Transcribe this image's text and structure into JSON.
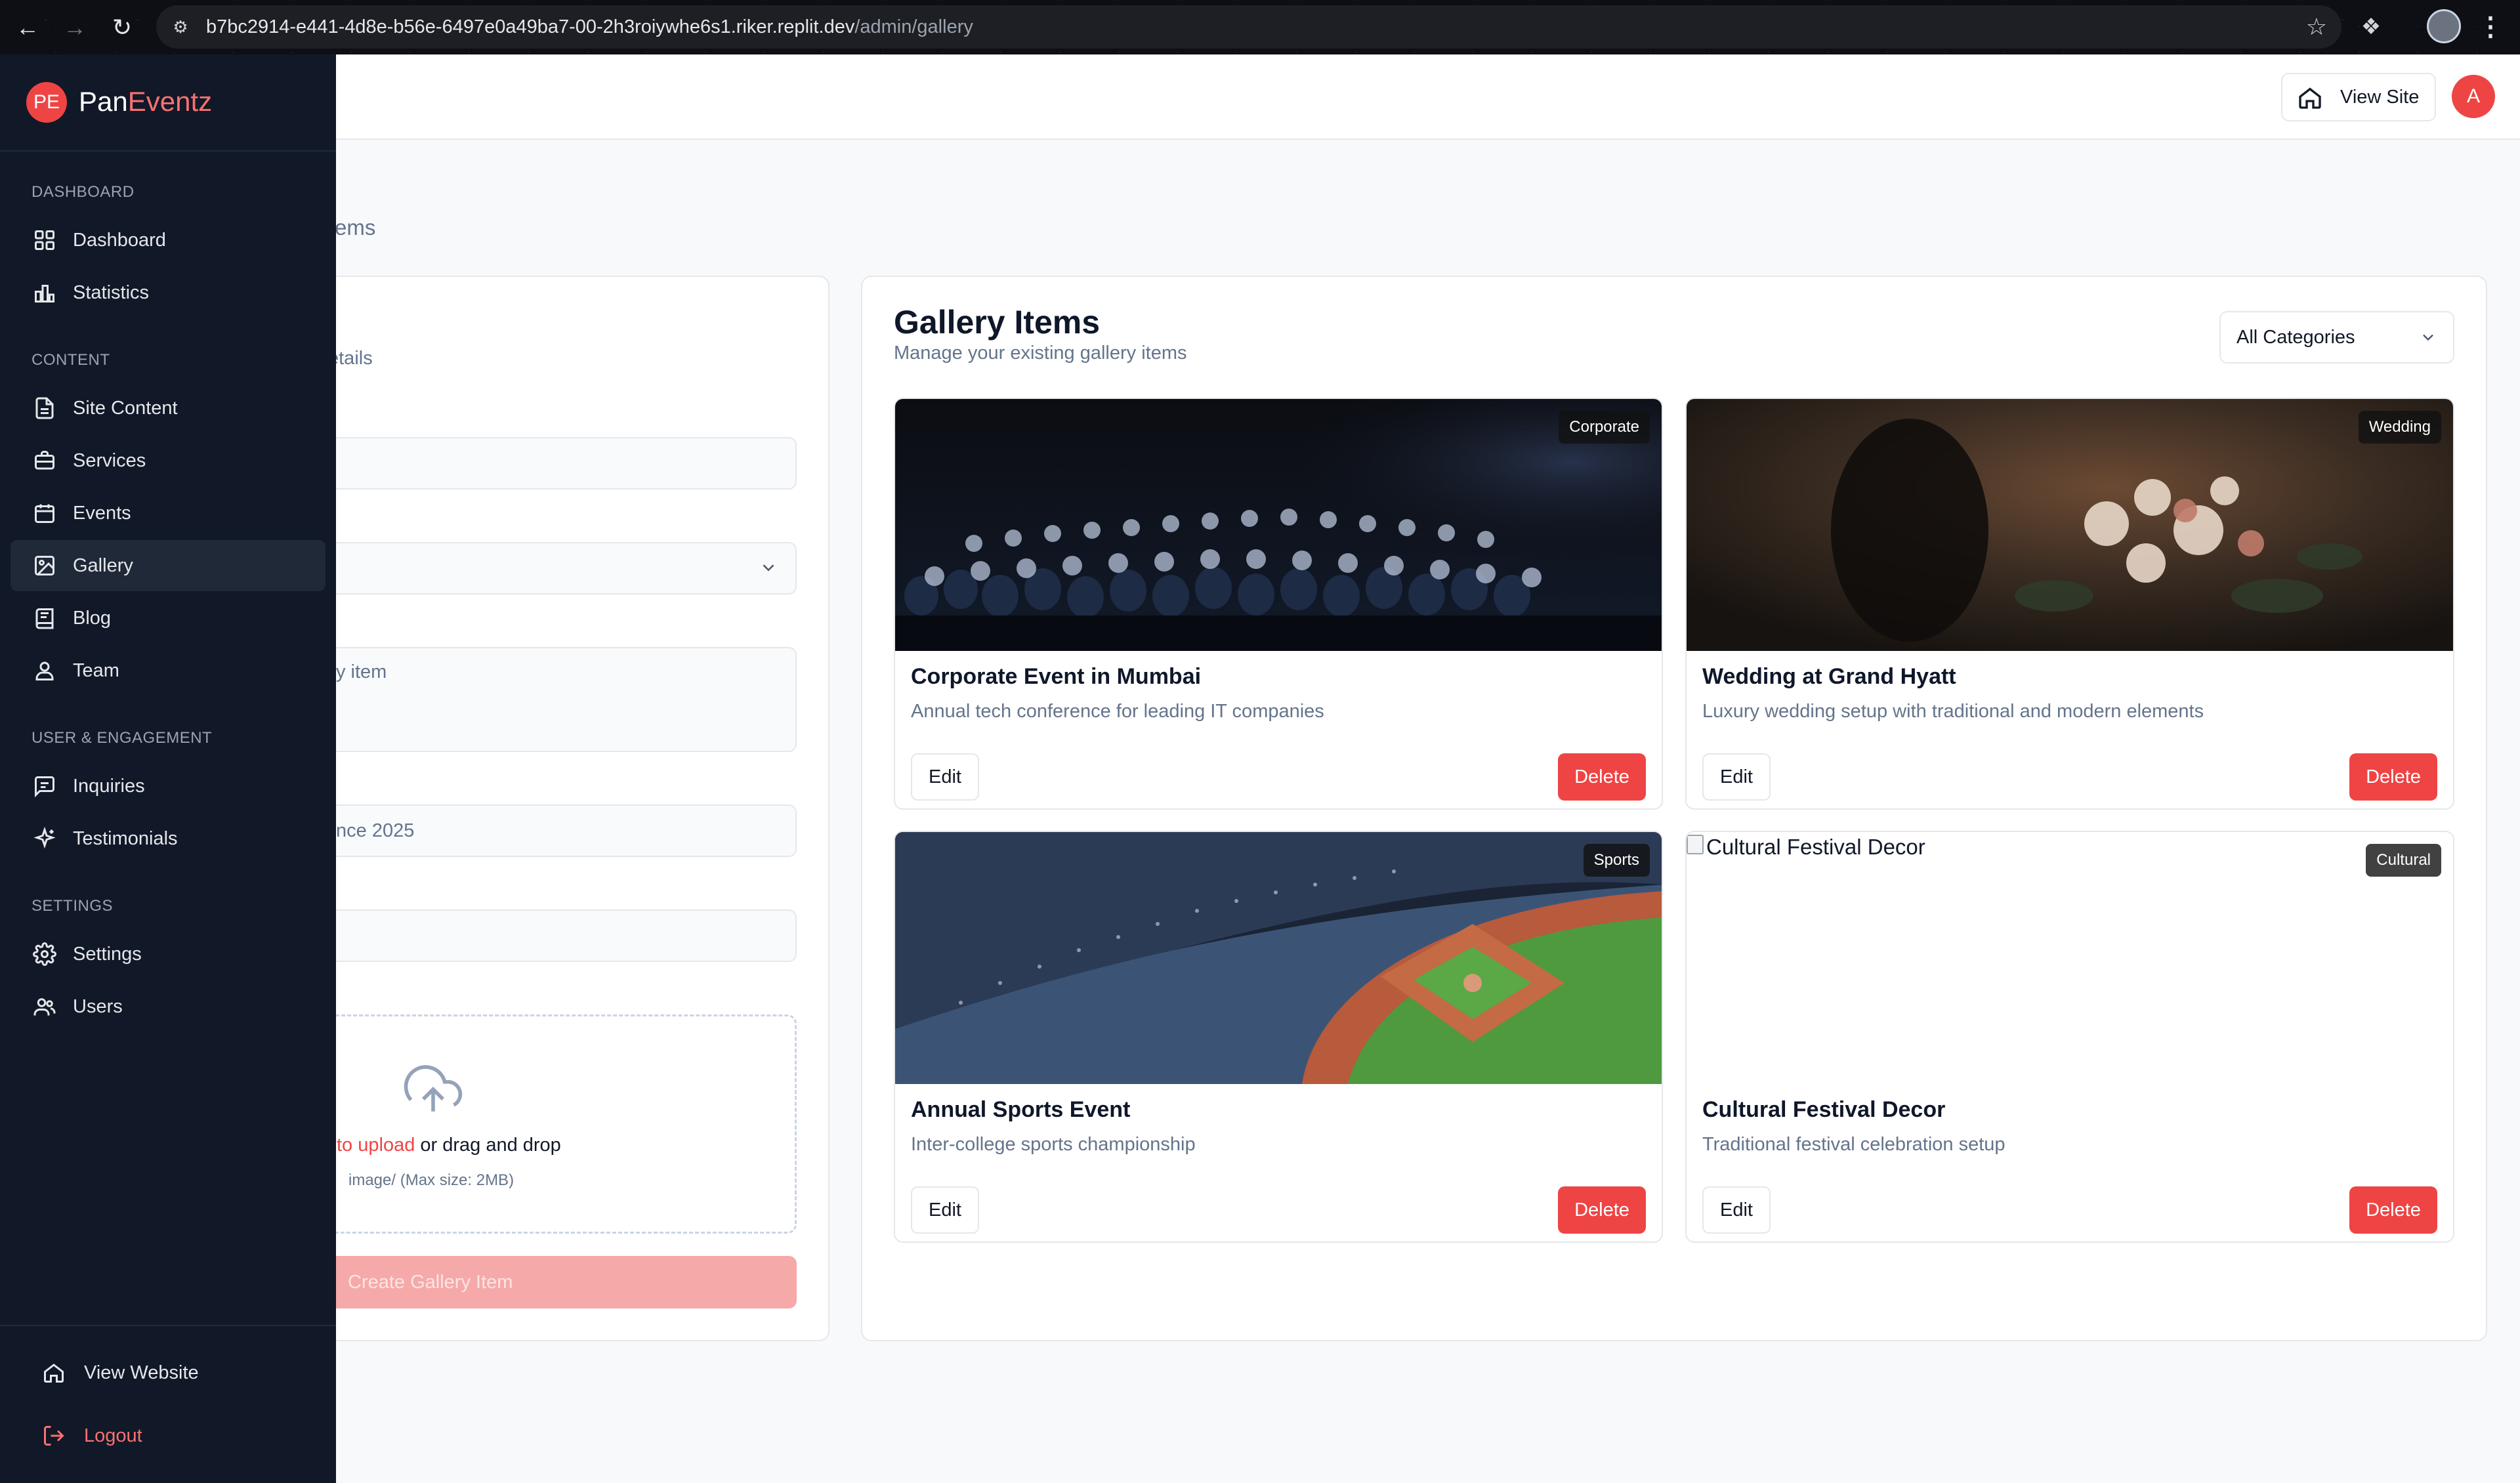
{
  "browser": {
    "url_host": "b7bc2914-e441-4d8e-b56e-6497e0a49ba7-00-2h3roiywhe6s1.riker.replit.dev",
    "url_path": "/admin/gallery"
  },
  "brand": {
    "mark": "PE",
    "name_part1": "Pan",
    "name_part2": "Eventz",
    "accent_color": "#ef4444"
  },
  "header": {
    "view_site_label": "View Site",
    "avatar_initial": "A"
  },
  "sidebar": {
    "sections": [
      {
        "title": "DASHBOARD",
        "items": [
          {
            "label": "Dashboard",
            "icon": "grid-icon"
          },
          {
            "label": "Statistics",
            "icon": "bar-chart-icon"
          }
        ]
      },
      {
        "title": "CONTENT",
        "items": [
          {
            "label": "Site Content",
            "icon": "file-text-icon"
          },
          {
            "label": "Services",
            "icon": "briefcase-icon"
          },
          {
            "label": "Events",
            "icon": "calendar-icon"
          },
          {
            "label": "Gallery",
            "icon": "image-icon",
            "active": true
          },
          {
            "label": "Blog",
            "icon": "book-icon"
          },
          {
            "label": "Team",
            "icon": "user-icon"
          }
        ]
      },
      {
        "title": "USER & ENGAGEMENT",
        "items": [
          {
            "label": "Inquiries",
            "icon": "message-icon"
          },
          {
            "label": "Testimonials",
            "icon": "sparkle-icon"
          }
        ]
      },
      {
        "title": "SETTINGS",
        "items": [
          {
            "label": "Settings",
            "icon": "gear-icon"
          },
          {
            "label": "Users",
            "icon": "users-icon"
          }
        ]
      }
    ],
    "footer": {
      "view_website": "View Website",
      "logout": "Logout"
    }
  },
  "page": {
    "breadcrumb_partial": "ems"
  },
  "form": {
    "subtitle_partial": "etails",
    "description_placeholder_partial": "y item",
    "date_value_partial": "nce 2025",
    "upload_link": "to upload",
    "upload_text": " or drag and drop",
    "upload_hint": "image/ (Max size: 2MB)",
    "submit_label": "Create Gallery Item"
  },
  "gallery": {
    "title": "Gallery Items",
    "subtitle": "Manage your existing gallery items",
    "filter_value": "All Categories",
    "edit_label": "Edit",
    "delete_label": "Delete",
    "items": [
      {
        "title": "Corporate Event in Mumbai",
        "description": "Annual tech conference for leading IT companies",
        "category": "Corporate"
      },
      {
        "title": "Wedding at Grand Hyatt",
        "description": "Luxury wedding setup with traditional and modern elements",
        "category": "Wedding"
      },
      {
        "title": "Annual Sports Event",
        "description": "Inter-college sports championship",
        "category": "Sports"
      },
      {
        "title": "Cultural Festival Decor",
        "description": "Traditional festival celebration setup",
        "category": "Cultural",
        "image_alt": "Cultural Festival Decor"
      }
    ]
  }
}
